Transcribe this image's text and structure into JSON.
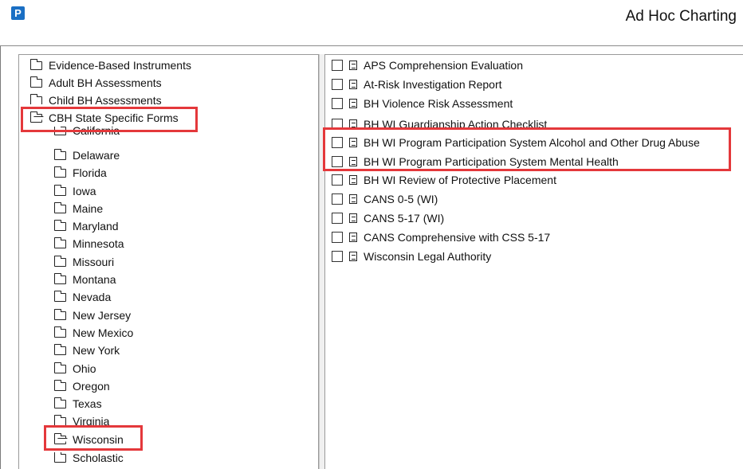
{
  "window": {
    "app_icon": "P",
    "title": "Ad Hoc Charting"
  },
  "tree": [
    {
      "label": "Evidence-Based Instruments",
      "open": false
    },
    {
      "label": "Adult BH Assessments",
      "open": false
    },
    {
      "label": "Child BH Assessments",
      "open": false
    },
    {
      "label": "CBH State Specific Forms",
      "open": true
    },
    {
      "label": "California",
      "open": false
    },
    {
      "label": "Delaware",
      "open": false
    },
    {
      "label": "Florida",
      "open": false
    },
    {
      "label": "Iowa",
      "open": false
    },
    {
      "label": "Maine",
      "open": false
    },
    {
      "label": "Maryland",
      "open": false
    },
    {
      "label": "Minnesota",
      "open": false
    },
    {
      "label": "Missouri",
      "open": false
    },
    {
      "label": "Montana",
      "open": false
    },
    {
      "label": "Nevada",
      "open": false
    },
    {
      "label": "New Jersey",
      "open": false
    },
    {
      "label": "New Mexico",
      "open": false
    },
    {
      "label": "New York",
      "open": false
    },
    {
      "label": "Ohio",
      "open": false
    },
    {
      "label": "Oregon",
      "open": false
    },
    {
      "label": "Texas",
      "open": false
    },
    {
      "label": "Virginia",
      "open": false
    },
    {
      "label": "Wisconsin",
      "open": true
    },
    {
      "label": "Scholastic",
      "open": false
    }
  ],
  "forms": [
    {
      "label": "APS Comprehension Evaluation",
      "checked": false
    },
    {
      "label": "At-Risk Investigation Report",
      "checked": false
    },
    {
      "label": "BH Violence Risk Assessment",
      "checked": false
    },
    {
      "label": "BH WI Guardianship Action Checklist",
      "checked": false
    },
    {
      "label": "BH WI Program Participation System Alcohol and Other Drug Abuse",
      "checked": false
    },
    {
      "label": "BH WI Program Participation System Mental Health",
      "checked": false
    },
    {
      "label": "BH WI Review of Protective Placement",
      "checked": false
    },
    {
      "label": "CANS 0-5 (WI)",
      "checked": false
    },
    {
      "label": "CANS 5-17 (WI)",
      "checked": false
    },
    {
      "label": "CANS Comprehensive with CSS 5-17",
      "checked": false
    },
    {
      "label": "Wisconsin Legal Authority",
      "checked": false
    }
  ],
  "colors": {
    "highlight": "#e4383b",
    "app_icon": "#1a6fc4"
  }
}
